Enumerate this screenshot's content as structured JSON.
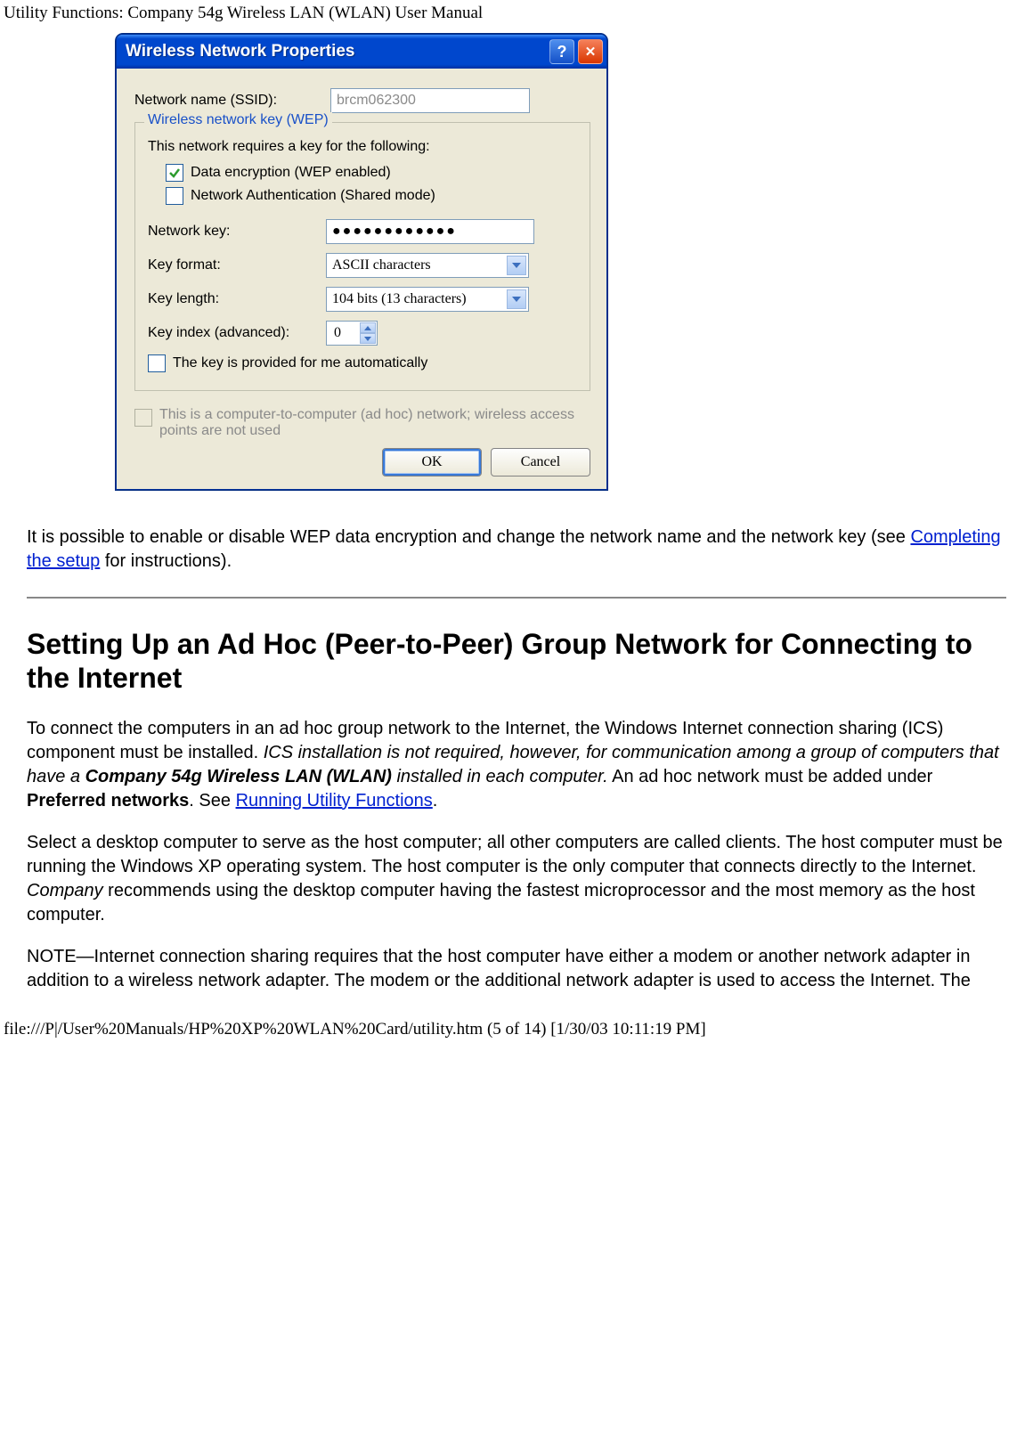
{
  "page_header": "Utility Functions: Company 54g Wireless LAN (WLAN) User Manual",
  "dialog": {
    "title": "Wireless Network Properties",
    "ssid_label": "Network name (SSID):",
    "ssid_value": "brcm062300",
    "wep_legend": "Wireless network key (WEP)",
    "requires_text": "This network requires a key for the following:",
    "cb_data_encryption": "Data encryption (WEP enabled)",
    "cb_auth": "Network Authentication (Shared mode)",
    "network_key_label": "Network key:",
    "network_key_value": "●●●●●●●●●●●●",
    "key_format_label": "Key format:",
    "key_format_value": "ASCII characters",
    "key_length_label": "Key length:",
    "key_length_value": "104 bits (13 characters)",
    "key_index_label": "Key index (advanced):",
    "key_index_value": "0",
    "cb_auto_key": "The key is provided for me automatically",
    "adhoc_text": "This is a computer-to-computer (ad hoc) network; wireless access points are not used",
    "ok": "OK",
    "cancel": "Cancel"
  },
  "para1_pre": "It is possible to enable or disable WEP data encryption and change the network name and the network key (see ",
  "para1_link": "Completing the setup",
  "para1_post": " for instructions).",
  "section_heading": "Setting Up an Ad Hoc (Peer-to-Peer) Group Network for Connecting to the Internet",
  "para2_a": "To connect the computers in an ad hoc group network to the Internet, the Windows Internet connection sharing (ICS) component must be installed. ",
  "para2_b": "ICS installation is not required, however, for communication among a group of computers that have a ",
  "para2_c": "Company 54g Wireless LAN (WLAN)",
  "para2_d": " installed in each computer.",
  "para2_e": " An ad hoc network must be added under ",
  "para2_f": "Preferred networks",
  "para2_g": ". See ",
  "para2_link": "Running Utility Functions",
  "para2_h": ".",
  "para3_a": "Select a desktop computer to serve as the host computer; all other computers are called clients. The host computer must be running the Windows XP operating system. The host computer is the only computer that connects directly to the Internet. ",
  "para3_b": "Company",
  "para3_c": " recommends using the desktop computer having the fastest microprocessor and the most memory as the host computer.",
  "para4": "NOTE—Internet connection sharing requires that the host computer have either a modem or another network adapter in addition to a wireless network adapter. The modem or the additional network adapter is used to access the Internet. The",
  "footer": "file:///P|/User%20Manuals/HP%20XP%20WLAN%20Card/utility.htm (5 of 14) [1/30/03 10:11:19 PM]"
}
